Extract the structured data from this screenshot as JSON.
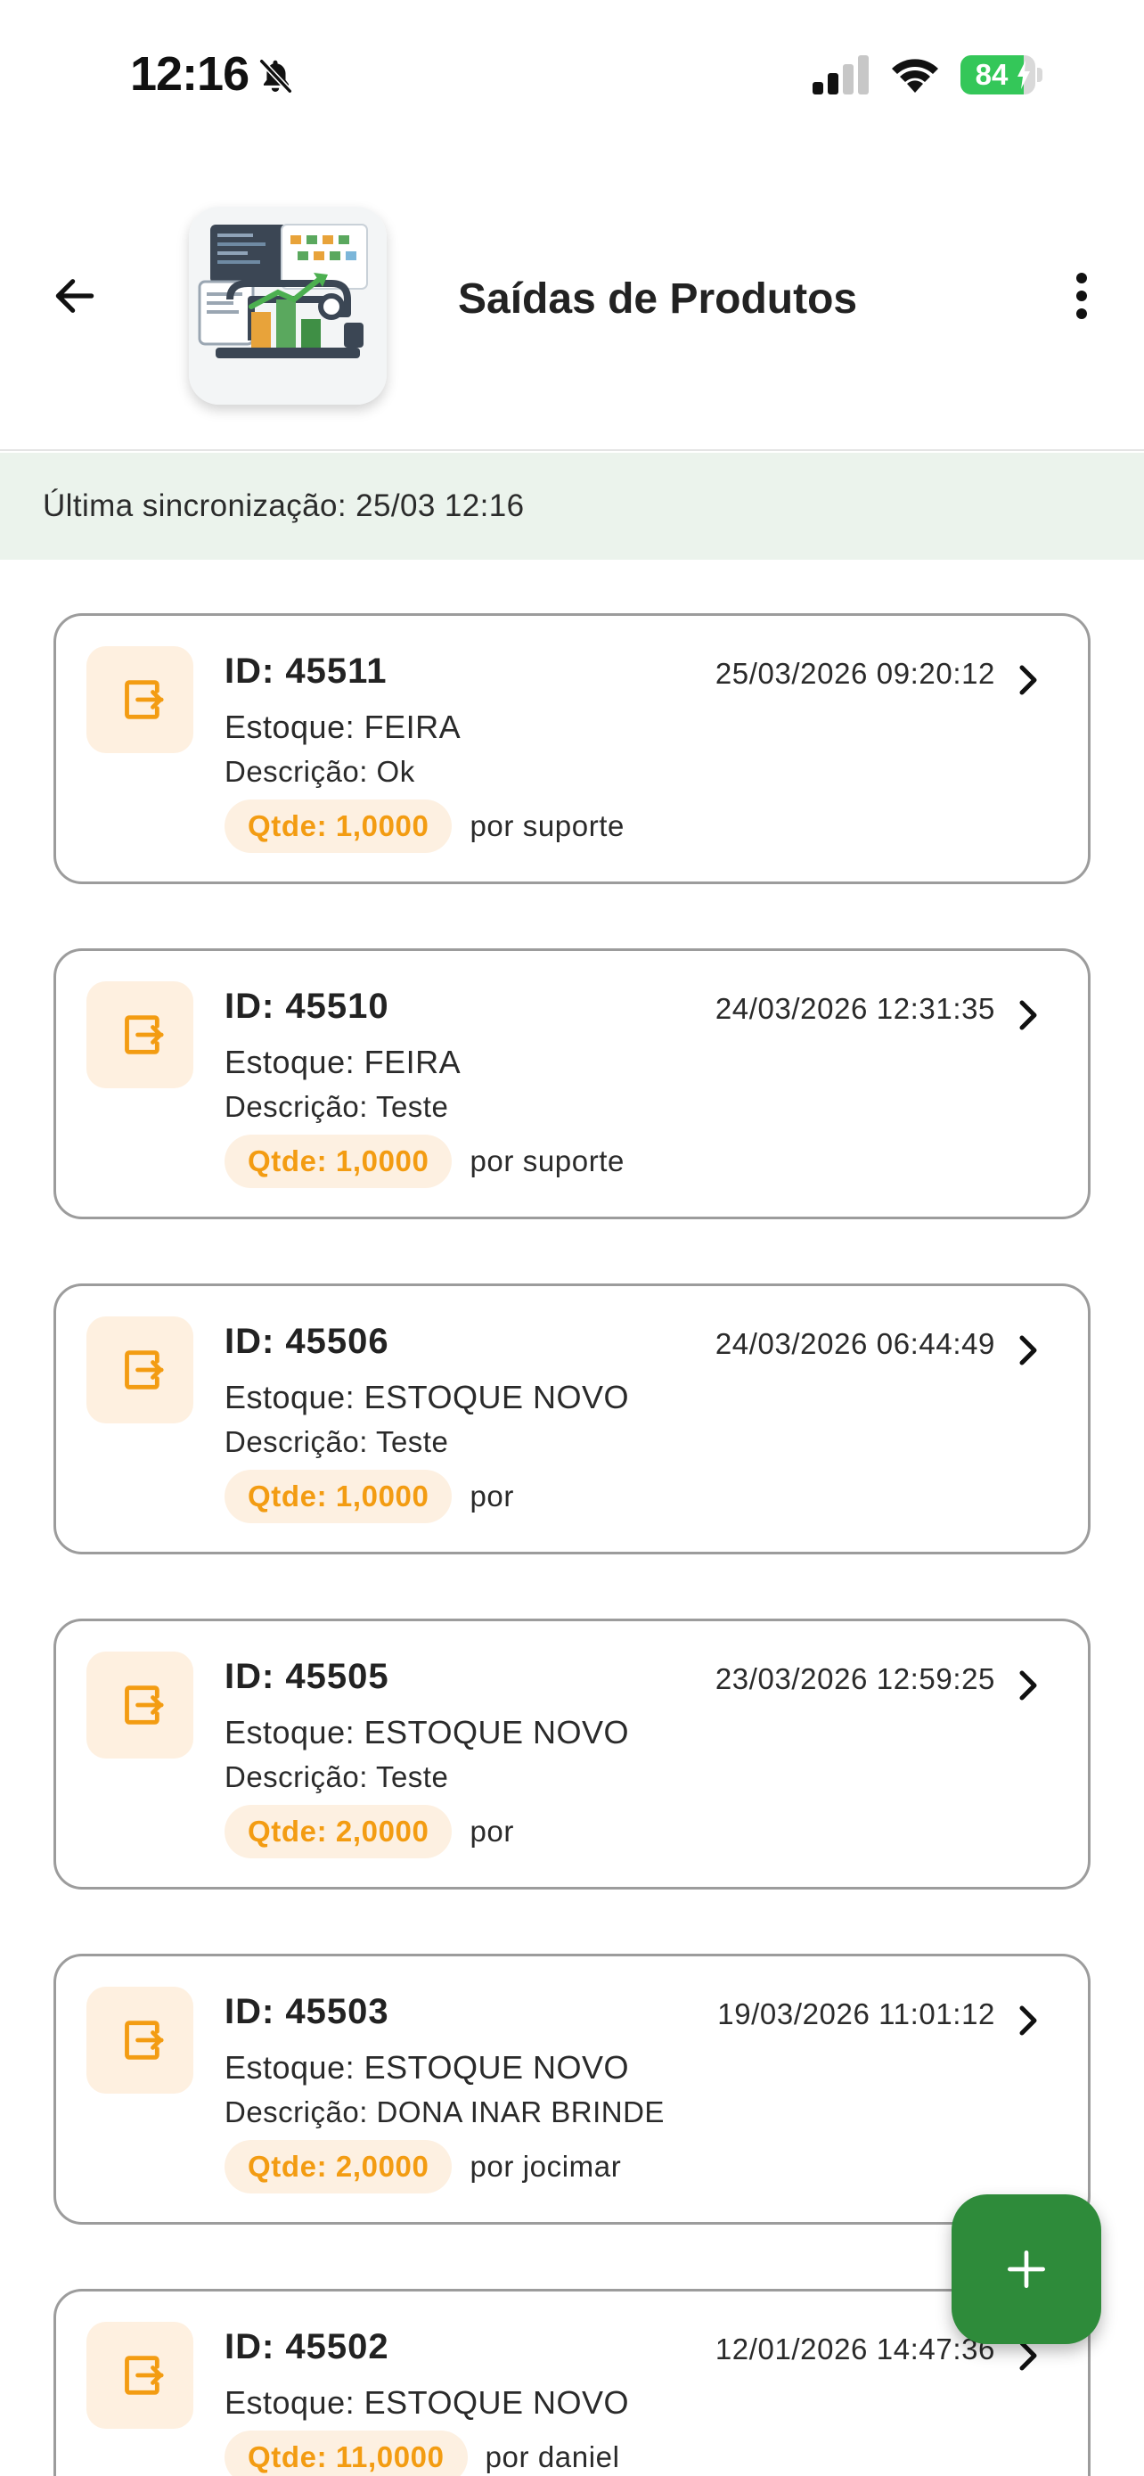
{
  "status_bar": {
    "time": "12:16",
    "battery_level": "84",
    "battery_fraction": 0.84,
    "icons": [
      "bell-slash-icon",
      "cellular-signal-icon",
      "wifi-icon",
      "battery-charging-icon"
    ]
  },
  "app_bar": {
    "title": "Saídas de Produtos",
    "back_icon": "arrow-left-icon",
    "menu_icon": "more-vertical-icon",
    "logo_icon": "sewing-machine-chart-logo"
  },
  "sync": {
    "text": "Última sincronização: 25/03 12:16"
  },
  "colors": {
    "accent_orange": "#f39c12",
    "pill_background": "#fdf0e1",
    "sync_background": "#ebf3ec",
    "fab_green": "#2e8b3a"
  },
  "items": [
    {
      "id": "ID: 45511",
      "date": "25/03/2026 09:20:12",
      "stock": "Estoque: FEIRA",
      "description": "Descrição: Ok",
      "qty": "Qtde: 1,0000",
      "user": "por suporte"
    },
    {
      "id": "ID: 45510",
      "date": "24/03/2026 12:31:35",
      "stock": "Estoque: FEIRA",
      "description": "Descrição: Teste",
      "qty": "Qtde: 1,0000",
      "user": "por suporte"
    },
    {
      "id": "ID: 45506",
      "date": "24/03/2026 06:44:49",
      "stock": "Estoque: ESTOQUE NOVO",
      "description": "Descrição: Teste",
      "qty": "Qtde: 1,0000",
      "user": "por"
    },
    {
      "id": "ID: 45505",
      "date": "23/03/2026 12:59:25",
      "stock": "Estoque: ESTOQUE NOVO",
      "description": "Descrição: Teste",
      "qty": "Qtde: 2,0000",
      "user": "por"
    },
    {
      "id": "ID: 45503",
      "date": "19/03/2026 11:01:12",
      "stock": "Estoque: ESTOQUE NOVO",
      "description": "Descrição: DONA INAR BRINDE",
      "qty": "Qtde: 2,0000",
      "user": "por jocimar"
    },
    {
      "id": "ID: 45502",
      "date": "12/01/2026 14:47:36",
      "stock": "Estoque: ESTOQUE NOVO",
      "description": "",
      "qty": "Qtde: 11,0000",
      "user": "por daniel"
    }
  ],
  "item_icon": "exit-box-icon",
  "fab": {
    "icon": "plus-icon"
  }
}
